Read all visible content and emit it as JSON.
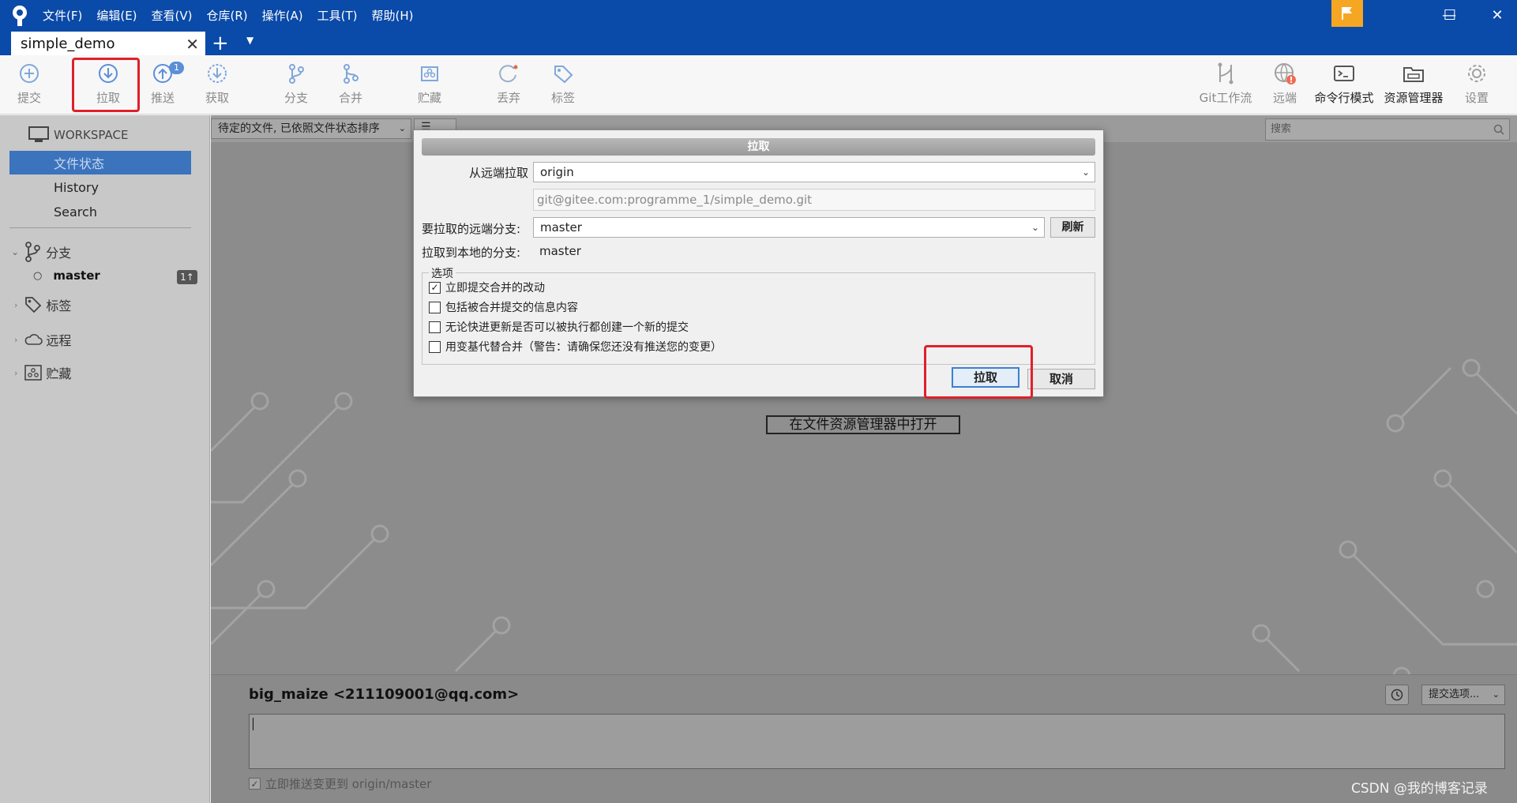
{
  "app": {
    "menu": [
      "文件(F)",
      "编辑(E)",
      "查看(V)",
      "仓库(R)",
      "操作(A)",
      "工具(T)",
      "帮助(H)"
    ],
    "tab_title": "simple_demo",
    "window_controls": {
      "minimize": "—",
      "maximize": "☐",
      "close": "✕"
    }
  },
  "toolbar": {
    "commit": "提交",
    "pull": "拉取",
    "push": "推送",
    "push_badge": "1",
    "fetch": "获取",
    "branch": "分支",
    "merge": "合并",
    "stash": "贮藏",
    "discard": "丢弃",
    "tag": "标签",
    "git_flow": "Git工作流",
    "remote": "远端",
    "terminal": "命令行模式",
    "explorer": "资源管理器",
    "settings": "设置"
  },
  "sidebar": {
    "workspace": "WORKSPACE",
    "file_status": "文件状态",
    "history": "History",
    "search": "Search",
    "branches": "分支",
    "branch_master": "master",
    "branch_master_count": "1↑",
    "tags": "标签",
    "remotes": "远程",
    "stashes": "贮藏"
  },
  "main": {
    "sort_select": "待定的文件, 已依照文件状态排序",
    "view_select": "☰",
    "search_placeholder": "搜索",
    "open_explorer": "在文件资源管理器中打开"
  },
  "commit": {
    "author": "big_maize <211109001@qq.com>",
    "options": "提交选项...",
    "push_immediately": "立即推送变更到 origin/master"
  },
  "dialog": {
    "title": "拉取",
    "remote_label": "从远端拉取",
    "remote_value": "origin",
    "remote_url": "git@gitee.com:programme_1/simple_demo.git",
    "remote_branch_label": "要拉取的远端分支:",
    "remote_branch_value": "master",
    "refresh": "刷新",
    "local_branch_label": "拉取到本地的分支:",
    "local_branch_value": "master",
    "options_legend": "选项",
    "options": [
      {
        "label": "立即提交合并的改动",
        "checked": true
      },
      {
        "label": "包括被合并提交的信息内容",
        "checked": false
      },
      {
        "label": "无论快进更新是否可以被执行都创建一个新的提交",
        "checked": false
      },
      {
        "label": "用变基代替合并（警告：请确保您还没有推送您的变更）",
        "checked": false
      }
    ],
    "ok": "拉取",
    "cancel": "取消"
  },
  "watermark": "CSDN @我的博客记录",
  "colors": {
    "titlebar": "#0a4aa8",
    "highlight": "#e0202a",
    "selected": "#3b73bd"
  }
}
